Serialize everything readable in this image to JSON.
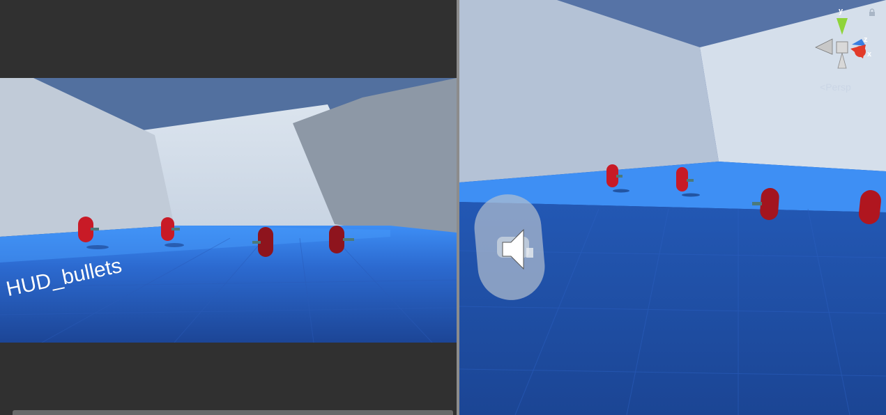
{
  "game_view": {
    "hud_label": "HUD_bullets"
  },
  "scene_view": {
    "gizmo": {
      "axis_y": "y",
      "axis_z": "z",
      "axis_x": "x",
      "projection_label": "Persp",
      "colors": {
        "y": "#8fd43a",
        "z": "#3a7ee0",
        "x": "#e23b2a"
      }
    },
    "audio_source_icon": "speaker-icon",
    "lock_icon": "lock-icon"
  },
  "colors": {
    "floor_light": "#3f8ff2",
    "floor_dark": "#1d4a9c",
    "wall": "#c6d0dc",
    "ceiling": "#4f6e9e",
    "enemy": "#c01824",
    "panel_bg": "#303030",
    "splitter": "#8c8c8c"
  }
}
